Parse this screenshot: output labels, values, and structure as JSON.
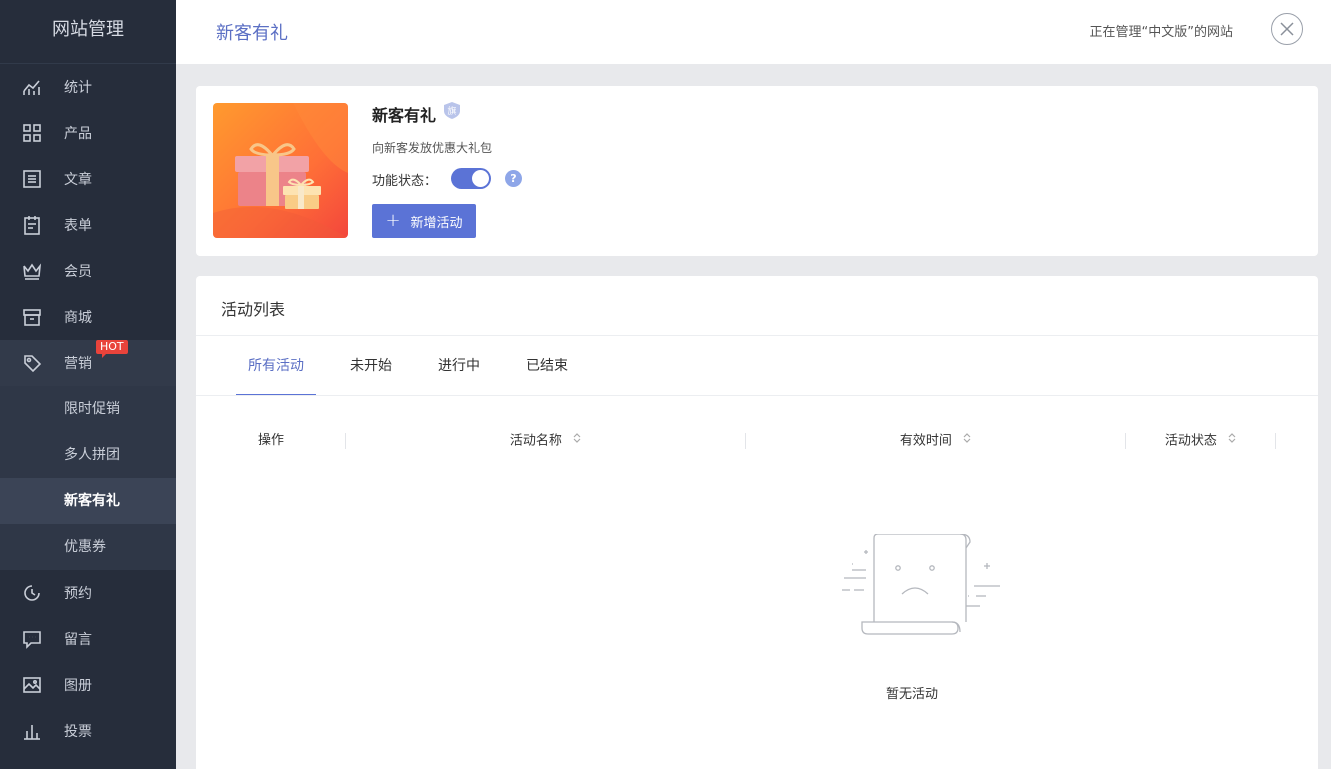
{
  "sidebar": {
    "title": "网站管理",
    "items": [
      {
        "label": "统计",
        "icon": "chart-line-icon"
      },
      {
        "label": "产品",
        "icon": "grid-icon"
      },
      {
        "label": "文章",
        "icon": "list-icon"
      },
      {
        "label": "表单",
        "icon": "clipboard-icon"
      },
      {
        "label": "会员",
        "icon": "crown-icon"
      },
      {
        "label": "商城",
        "icon": "store-icon"
      },
      {
        "label": "营销",
        "icon": "tag-icon",
        "badge": "HOT"
      }
    ],
    "sub_items": [
      {
        "label": "限时促销"
      },
      {
        "label": "多人拼团"
      },
      {
        "label": "新客有礼"
      },
      {
        "label": "优惠券"
      }
    ],
    "items_after": [
      {
        "label": "预约",
        "icon": "clock-icon"
      },
      {
        "label": "留言",
        "icon": "message-icon"
      },
      {
        "label": "图册",
        "icon": "image-icon"
      },
      {
        "label": "投票",
        "icon": "bar-chart-icon"
      }
    ]
  },
  "header": {
    "title": "新客有礼",
    "manage_hint": "正在管理“中文版”的网站"
  },
  "feature": {
    "name": "新客有礼",
    "badge": "旗",
    "description": "向新客发放优惠大礼包",
    "status_label": "功能状态：",
    "enabled": true,
    "help": "?",
    "add_button": "新增活动",
    "add_icon": "+"
  },
  "list": {
    "title": "活动列表",
    "tabs": [
      "所有活动",
      "未开始",
      "进行中",
      "已结束"
    ],
    "active_tab": 0,
    "columns": [
      "操作",
      "活动名称",
      "有效时间",
      "活动状态"
    ],
    "empty_text": "暂无活动"
  },
  "colors": {
    "accent": "#5b73d6",
    "sidebar_bg": "#262d3b",
    "hot_badge": "#e9433b"
  }
}
